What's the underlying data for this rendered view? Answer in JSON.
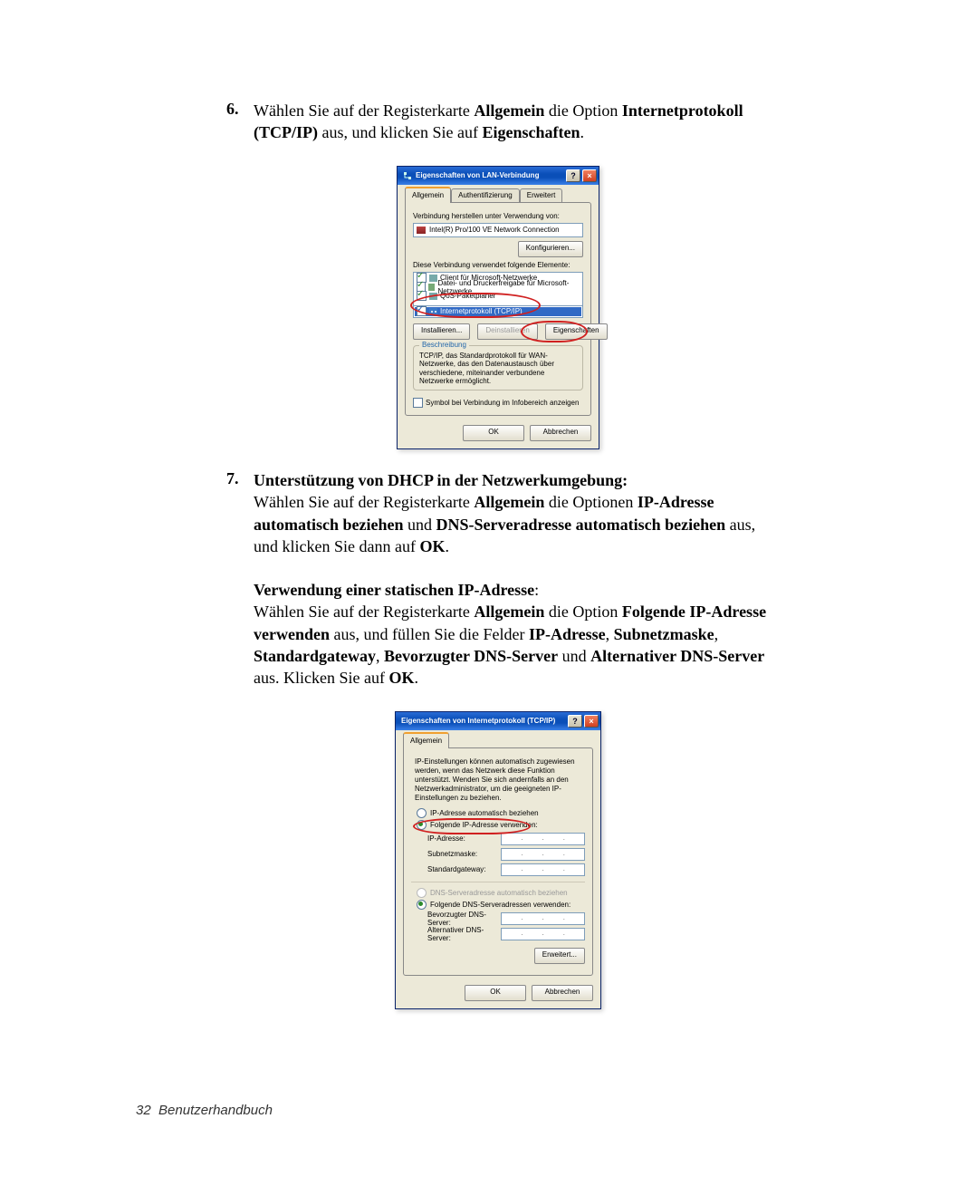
{
  "step6": {
    "num": "6.",
    "t1": "Wählen Sie auf der Registerkarte ",
    "b1": "Allgemein",
    "t2": " die Option ",
    "b2": "Internetprotokoll (TCP/IP)",
    "t3": " aus, und klicken Sie auf ",
    "b3": "Eigenschaften",
    "t4": "."
  },
  "dlg1": {
    "title": "Eigenschaften von LAN-Verbindung",
    "tabs": {
      "t1": "Allgemein",
      "t2": "Authentifizierung",
      "t3": "Erweitert"
    },
    "conn_label": "Verbindung herstellen unter Verwendung von:",
    "adapter": "Intel(R) Pro/100 VE Network Connection",
    "configure": "Konfigurieren...",
    "uses_label": "Diese Verbindung verwendet folgende Elemente:",
    "items": {
      "i1": "Client für Microsoft-Netzwerke",
      "i2": "Datei- und Druckerfreigabe für Microsoft-Netzwerke",
      "i3": "QoS-Paketplaner",
      "i4": "Internetprotokoll (TCP/IP)"
    },
    "btn_install": "Installieren...",
    "btn_uninstall": "Deinstallieren",
    "btn_props": "Eigenschaften",
    "group_title": "Beschreibung",
    "desc": "TCP/IP, das Standardprotokoll für WAN-Netzwerke, das den Datenaustausch über verschiedene, miteinander verbundene Netzwerke ermöglicht.",
    "chk_tray": "Symbol bei Verbindung im Infobereich anzeigen",
    "ok": "OK",
    "cancel": "Abbrechen"
  },
  "step7": {
    "num": "7.",
    "head": "Unterstützung von DHCP in der Netzwerkumgebung:",
    "p1a": "Wählen Sie auf der Registerkarte ",
    "p1b": "Allgemein",
    "p1c": " die Optionen ",
    "p1d": "IP-Adresse automatisch beziehen",
    "p1e": " und ",
    "p1f": "DNS-Serveradresse automatisch beziehen",
    "p1g": " aus, und klicken Sie dann auf ",
    "p1h": "OK",
    "p1i": ".",
    "head2": "Verwendung einer statischen IP-Adresse",
    "head2_colon": ":",
    "q1a": "Wählen Sie auf der Registerkarte ",
    "q1b": "Allgemein",
    "q1c": " die Option ",
    "q1d": "Folgende IP-Adresse verwenden",
    "q1e": " aus, und füllen Sie die Felder ",
    "q1f": "IP-Adresse",
    "q1g": ", ",
    "q1h": "Subnetzmaske",
    "q1i": ", ",
    "q1j": "Standardgateway",
    "q1k": ", ",
    "q1l": "Bevorzugter DNS-Server",
    "q1m": " und ",
    "q1n": "Alternativer DNS-Server",
    "q1o": " aus. Klicken Sie auf ",
    "q1p": "OK",
    "q1q": "."
  },
  "dlg2": {
    "title": "Eigenschaften von Internetprotokoll (TCP/IP)",
    "tab": "Allgemein",
    "para": "IP-Einstellungen können automatisch zugewiesen werden, wenn das Netzwerk diese Funktion unterstützt. Wenden Sie sich andernfalls an den Netzwerkadministrator, um die geeigneten IP-Einstellungen zu beziehen.",
    "r1": "IP-Adresse automatisch beziehen",
    "r2": "Folgende IP-Adresse verwenden:",
    "f_ip": "IP-Adresse:",
    "f_mask": "Subnetzmaske:",
    "f_gw": "Standardgateway:",
    "r3": "DNS-Serveradresse automatisch beziehen",
    "r4": "Folgende DNS-Serveradressen verwenden:",
    "f_dns1": "Bevorzugter DNS-Server:",
    "f_dns2": "Alternativer DNS-Server:",
    "adv": "Erweitert...",
    "ok": "OK",
    "cancel": "Abbrechen"
  },
  "footer": {
    "page": "32",
    "label": "Benutzerhandbuch"
  }
}
